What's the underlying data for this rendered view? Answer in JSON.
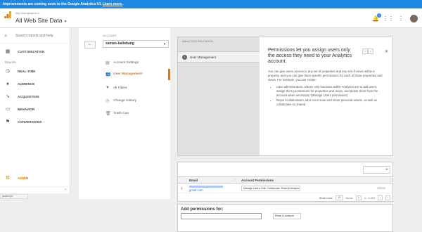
{
  "banner": {
    "text": "Improvements are coming soon to the Google Analytics UI.",
    "link": "Learn more."
  },
  "header": {
    "breadcrumb": "http://karajtejarat.ir/",
    "property": "All Web Site Data",
    "notification_count": "1",
    "icons": [
      "bell-icon",
      "apps-icon",
      "more-vert-icon",
      "avatar"
    ]
  },
  "sidebar": {
    "search_placeholder": "Search reports and help",
    "customization": "CUSTOMIZATION",
    "reports_header": "Reports",
    "items": [
      {
        "label": "REAL-TIME",
        "icon": "clock-icon"
      },
      {
        "label": "AUDIENCE",
        "icon": "person-icon"
      },
      {
        "label": "ACQUISITION",
        "icon": "acquisition-icon"
      },
      {
        "label": "BEHAVIOR",
        "icon": "behavior-icon"
      },
      {
        "label": "CONVERSIONS",
        "icon": "flag-icon"
      }
    ],
    "admin": "ADMIN"
  },
  "status_bar": "javascript:",
  "account": {
    "label": "ACCOUNT",
    "selected": "saman-baliahang",
    "menu": [
      {
        "label": "Account Settings",
        "icon": "building-icon",
        "active": false
      },
      {
        "label": "User Management",
        "icon": "users-icon",
        "active": true
      },
      {
        "label": "All Filters",
        "icon": "filter-icon",
        "active": false
      },
      {
        "label": "Change History",
        "icon": "history-icon",
        "active": false
      },
      {
        "label": "Trash Can",
        "icon": "trash-icon",
        "active": false
      }
    ]
  },
  "education": {
    "tag": "ANALYTICS EDUCATION",
    "item": "User Management",
    "heading": "Permissions let you assign users only the access they need to your Analytics account.",
    "body": "You can give users access to any set of properties and any set of views within a property, and you can give them specific permissions for each of those properties and views. For example, you can create:",
    "bullets": [
      "User administrators, whose only functions within Analytics are to add users, assign them permissions for properties and views, and delete them from the account when necessary (Manage Users permission)",
      "Report collaborators, who can create and share personal assets, as well as collaborate on shared"
    ]
  },
  "users_table": {
    "columns": [
      "Email",
      "Account Permissions"
    ],
    "rows": [
      {
        "num": "1.",
        "email_suffix": "gmail.com",
        "permissions": "Manage Users, Edit, Collaborate, Read & Analyze",
        "action": "delete"
      }
    ],
    "pager": {
      "show_rows_label": "Show rows:",
      "rows": "10",
      "goto_label": "Go to:",
      "goto": "1",
      "range": "1 - 1 of 1"
    }
  },
  "add_permissions": {
    "title": "Add permissions for:",
    "select": "Read & Analyze"
  }
}
